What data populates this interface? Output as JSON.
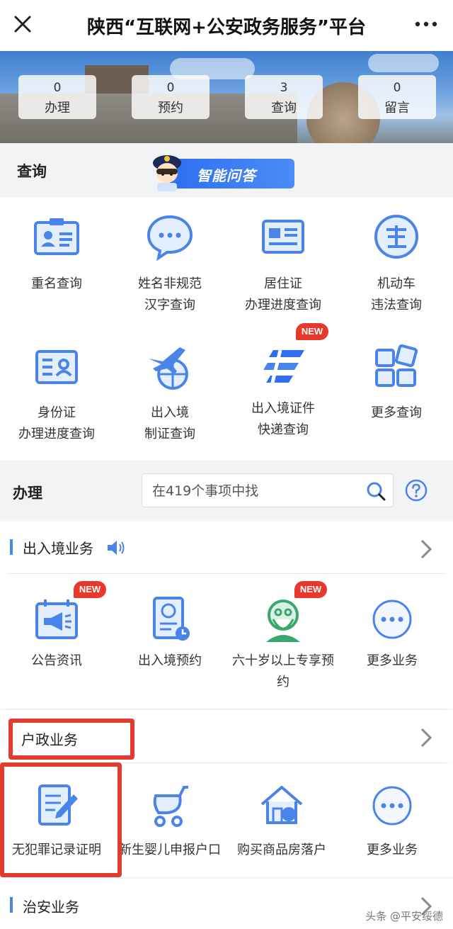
{
  "header": {
    "title": "陕西“互联网+公安政务服务”平台"
  },
  "stats": [
    {
      "num": "0",
      "label": "办理"
    },
    {
      "num": "0",
      "label": "预约"
    },
    {
      "num": "3",
      "label": "查询"
    },
    {
      "num": "0",
      "label": "留言"
    }
  ],
  "query": {
    "title": "查询",
    "ai_label": "智能问答",
    "items": [
      {
        "line1": "重名查询",
        "line2": "",
        "icon": "id-card-icon"
      },
      {
        "line1": "姓名非规范",
        "line2": "汉字查询",
        "icon": "chat-bubble-icon"
      },
      {
        "line1": "居住证",
        "line2": "办理进度查询",
        "icon": "residence-card-icon"
      },
      {
        "line1": "机动车",
        "line2": "违法查询",
        "icon": "violation-icon"
      },
      {
        "line1": "身份证",
        "line2": "办理进度查询",
        "icon": "id-card-outline-icon"
      },
      {
        "line1": "出入境",
        "line2": "制证查询",
        "icon": "airplane-globe-icon"
      },
      {
        "line1": "出入境证件",
        "line2": "快递查询",
        "icon": "postal-icon",
        "badge": "NEW"
      },
      {
        "line1": "更多查询",
        "line2": "",
        "icon": "grid-icon"
      }
    ]
  },
  "handle": {
    "title": "办理",
    "search_placeholder": "在419个事项中找"
  },
  "categories": {
    "exit_entry": {
      "name": "出入境业务",
      "items": [
        {
          "line1": "公告资讯",
          "line2": "",
          "icon": "announcement-icon",
          "badge": "NEW"
        },
        {
          "line1": "出入境预约",
          "line2": "",
          "icon": "passport-icon"
        },
        {
          "line1": "六十岁以上专享预",
          "line2": "约",
          "icon": "elder-icon",
          "badge": "NEW"
        },
        {
          "line1": "更多业务",
          "line2": "",
          "icon": "more-dots-icon"
        }
      ]
    },
    "household": {
      "name": "户政业务",
      "items": [
        {
          "line1": "无犯罪记录证明",
          "icon": "document-pen-icon"
        },
        {
          "line1": "新生婴儿申报户口",
          "icon": "baby-stroller-icon"
        },
        {
          "line1": "购买商品房落户",
          "icon": "house-icon"
        },
        {
          "line1": "更多业务",
          "icon": "more-dots-icon"
        }
      ]
    },
    "security": {
      "name": "治安业务"
    }
  },
  "watermark": "头条 @平安绥德",
  "colors": {
    "accent": "#4a84e8",
    "highlight": "#e23b30",
    "new_badge": "#e8382c"
  }
}
